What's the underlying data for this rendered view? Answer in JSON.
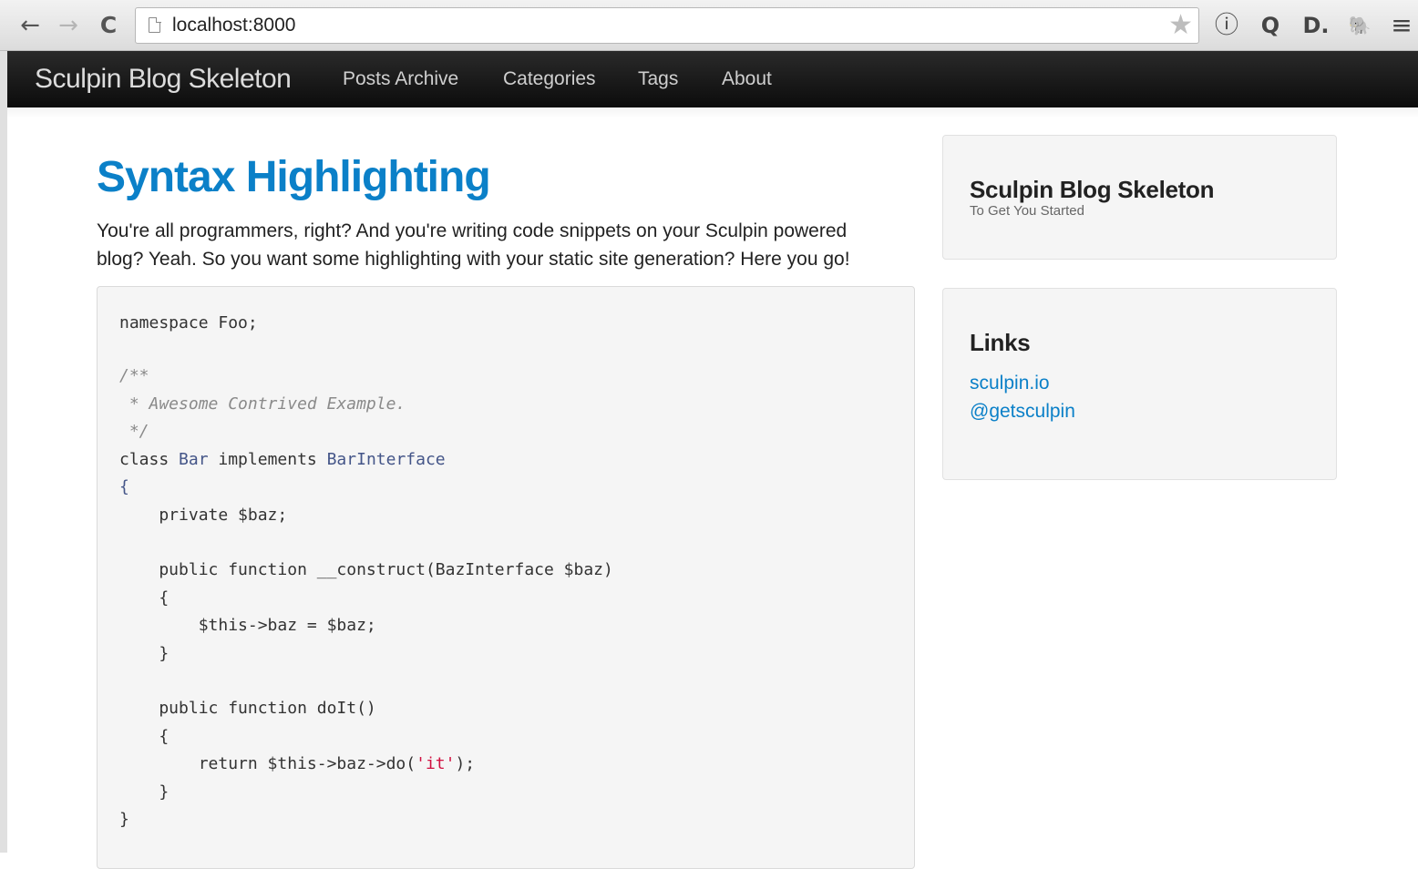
{
  "browser": {
    "url": "localhost:8000",
    "icons": [
      "back-arrow-icon",
      "forward-arrow-icon",
      "reload-icon",
      "page-icon",
      "bookmark-star-icon",
      "info-circle-icon",
      "magnifier-icon",
      "d-extension-icon",
      "evernote-elephant-icon",
      "menu-icon"
    ],
    "glyphs": {
      "back": "←",
      "forward": "→",
      "reload": "C",
      "star": "★",
      "info": "ⓘ",
      "search": "Q",
      "d_ext": "D.",
      "elephant": "🐘",
      "menu": "≡"
    }
  },
  "navbar": {
    "brand": "Sculpin Blog Skeleton",
    "links": [
      "Posts Archive",
      "Categories",
      "Tags",
      "About"
    ]
  },
  "post": {
    "title": "Syntax Highlighting",
    "intro_line1": "You're all programmers, right? And you're writing code snippets on your Sculpin powered",
    "intro_line2": "blog? Yeah. So you want some highlighting with your static site generation? Here you go!",
    "code": {
      "l1": "namespace Foo;",
      "l3": "/**",
      "l4": " * Awesome Contrived Example.",
      "l5": " */",
      "l6_kw": "class ",
      "l6_name": "Bar",
      "l6_kw2": " implements ",
      "l6_iface": "BarInterface",
      "l7": "{",
      "l8": "    private $baz;",
      "l10": "    public function __construct(BazInterface $baz)",
      "l11": "    {",
      "l12": "        $this->baz = $baz;",
      "l13": "    }",
      "l15": "    public function doIt()",
      "l16": "    {",
      "l17_a": "        return $this->baz->do(",
      "l17_str": "'it'",
      "l17_b": ");",
      "l18": "    }",
      "l19": "}"
    }
  },
  "sidebar": {
    "about": {
      "title": "Sculpin Blog Skeleton",
      "subtitle": "To Get You Started"
    },
    "links": {
      "title": "Links",
      "items": [
        "sculpin.io",
        "@getsculpin"
      ]
    }
  },
  "colors": {
    "accent": "#0b80c8",
    "navbar": "#111111",
    "code_bg": "#f5f5f5",
    "class_name": "#445588",
    "string": "#d01040"
  }
}
